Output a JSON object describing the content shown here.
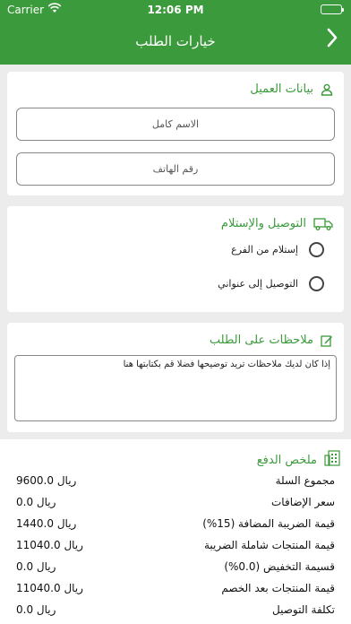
{
  "status_bar": {
    "carrier": "Carrier",
    "time": "12:06 PM"
  },
  "header": {
    "title": "خيارات الطلب"
  },
  "customer": {
    "heading": "بيانات العميل",
    "name_placeholder": "الاسم كامل",
    "phone_placeholder": "رقم الهاتف"
  },
  "delivery": {
    "heading": "التوصيل والإستلام",
    "options": [
      "إستلام من الفرع",
      "التوصيل إلى عنواني"
    ]
  },
  "notes": {
    "heading": "ملاحظات على الطلب",
    "placeholder": "إذا كان لديك ملاحظات تريد توضيحها فضلا قم بكتابتها هنا"
  },
  "summary": {
    "heading": "ملخص الدفع",
    "rows": [
      {
        "label": "مجموع السلة",
        "value": "9600.0 ريال"
      },
      {
        "label": "سعر الإضافات",
        "value": "0.0 ريال"
      },
      {
        "label": "قيمة الضريبة المضافة (15%)",
        "value": "1440.0 ريال"
      },
      {
        "label": "قيمة المنتجات شاملة الضريبة",
        "value": "11040.0 ريال"
      },
      {
        "label": "قسيمة التخفيض (0.0%)",
        "value": "0.0 ريال"
      },
      {
        "label": "قيمة المنتجات بعد الخصم",
        "value": "11040.0 ريال"
      },
      {
        "label": "تكلفة التوصيل",
        "value": "0.0 ريال"
      }
    ]
  },
  "colors": {
    "primary": "#3b9a3b",
    "background": "#ececec"
  }
}
